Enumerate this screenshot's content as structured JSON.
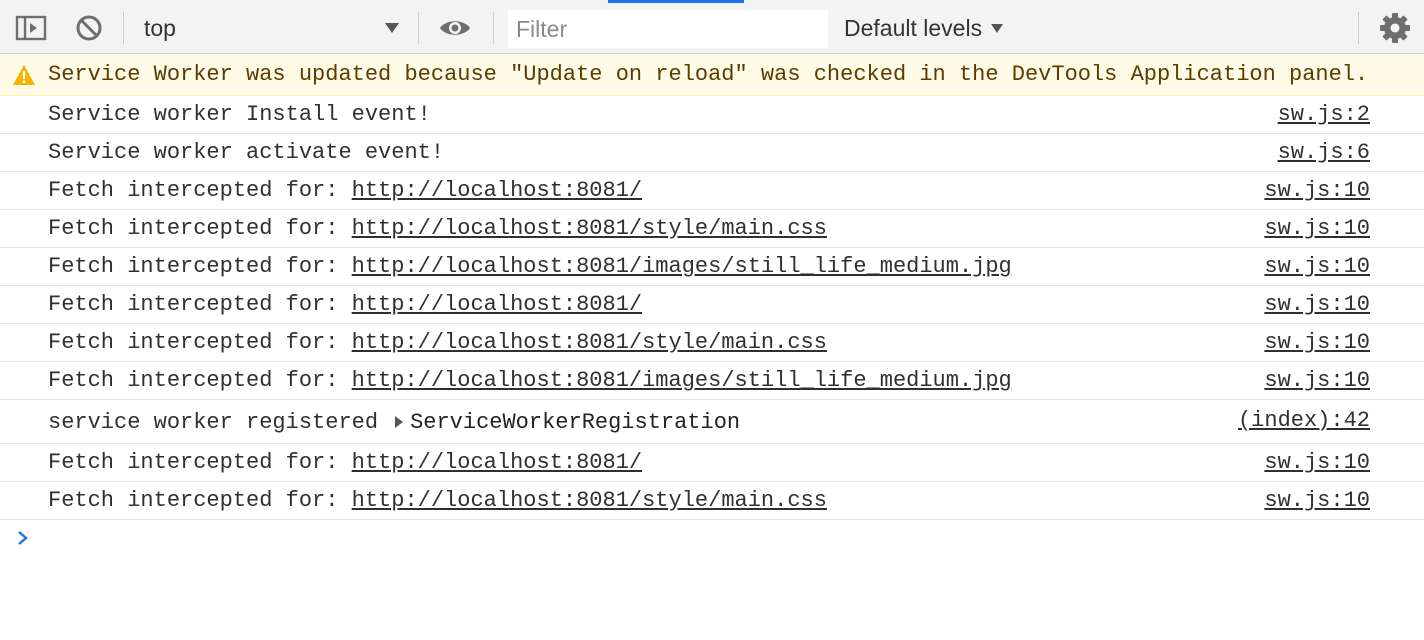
{
  "toolbar": {
    "context": "top",
    "filter_placeholder": "Filter",
    "levels_label": "Default levels"
  },
  "warning": {
    "text": "Service Worker was updated because \"Update on reload\" was checked in the DevTools Application panel."
  },
  "messages": [
    {
      "text": "Service worker Install event!",
      "source": "sw.js:2"
    },
    {
      "text": "Service worker activate event!",
      "source": "sw.js:6"
    },
    {
      "text": "Fetch intercepted for: ",
      "url": "http://localhost:8081/",
      "source": "sw.js:10"
    },
    {
      "text": "Fetch intercepted for: ",
      "url": "http://localhost:8081/style/main.css",
      "source": "sw.js:10"
    },
    {
      "text": "Fetch intercepted for: ",
      "url": "http://localhost:8081/images/still_life_medium.jpg",
      "source": "sw.js:10"
    },
    {
      "text": "Fetch intercepted for: ",
      "url": "http://localhost:8081/",
      "source": "sw.js:10"
    },
    {
      "text": "Fetch intercepted for: ",
      "url": "http://localhost:8081/style/main.css",
      "source": "sw.js:10"
    },
    {
      "text": "Fetch intercepted for: ",
      "url": "http://localhost:8081/images/still_life_medium.jpg",
      "source": "sw.js:10"
    },
    {
      "text": "service worker registered",
      "object": "ServiceWorkerRegistration",
      "source": "(index):42"
    },
    {
      "text": "Fetch intercepted for: ",
      "url": "http://localhost:8081/",
      "source": "sw.js:10"
    },
    {
      "text": "Fetch intercepted for: ",
      "url": "http://localhost:8081/style/main.css",
      "source": "sw.js:10"
    }
  ],
  "colors": {
    "accent": "#1a73e8",
    "warning_bg": "#fffbe6",
    "warning_text": "#5c3b00",
    "warning_icon": "#f4b400"
  }
}
